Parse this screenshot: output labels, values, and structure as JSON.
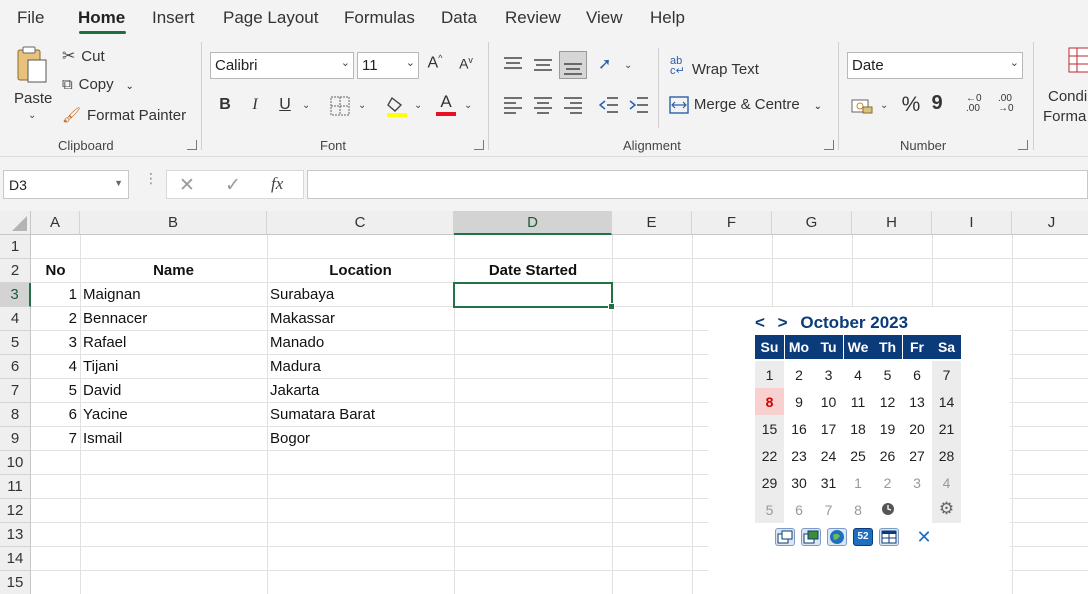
{
  "menu": {
    "tabs": [
      {
        "label": "File"
      },
      {
        "label": "Home"
      },
      {
        "label": "Insert"
      },
      {
        "label": "Page Layout"
      },
      {
        "label": "Formulas"
      },
      {
        "label": "Data"
      },
      {
        "label": "Review"
      },
      {
        "label": "View"
      },
      {
        "label": "Help"
      }
    ],
    "active_tab": "Home"
  },
  "ribbon": {
    "clipboard": {
      "paste": "Paste",
      "cut": "Cut",
      "copy": "Copy",
      "format_painter": "Format Painter",
      "group_label": "Clipboard"
    },
    "font": {
      "font_name": "Calibri",
      "font_size": "11",
      "bold": "B",
      "italic": "I",
      "underline": "U",
      "font_color": "#e81123",
      "highlight_color": "#ffff00",
      "group_label": "Font"
    },
    "alignment": {
      "wrap_text": "Wrap Text",
      "merge_centre": "Merge & Centre",
      "group_label": "Alignment"
    },
    "number": {
      "format": "Date",
      "percent": "%",
      "comma": "9",
      "group_label": "Number"
    },
    "cond_format": {
      "label_line1": "Condi",
      "label_line2": "Forma"
    }
  },
  "formula_bar": {
    "name_box": "D3",
    "fx": "fx",
    "formula": ""
  },
  "sheet": {
    "columns": [
      "A",
      "B",
      "C",
      "D",
      "E",
      "F",
      "G",
      "H",
      "I",
      "J"
    ],
    "selected_column": "D",
    "rows": [
      "1",
      "2",
      "3",
      "4",
      "5",
      "6",
      "7",
      "8",
      "9",
      "10",
      "11",
      "12",
      "13",
      "14",
      "15"
    ],
    "selected_row": "3",
    "headers": {
      "no": "No",
      "name": "Name",
      "location": "Location",
      "date_started": "Date Started"
    },
    "records": [
      {
        "no": "1",
        "name": "Maignan",
        "location": "Surabaya"
      },
      {
        "no": "2",
        "name": "Bennacer",
        "location": "Makassar"
      },
      {
        "no": "3",
        "name": "Rafael",
        "location": "Manado"
      },
      {
        "no": "4",
        "name": "Tijani",
        "location": "Madura"
      },
      {
        "no": "5",
        "name": "David",
        "location": "Jakarta"
      },
      {
        "no": "6",
        "name": "Yacine",
        "location": "Sumatara Barat"
      },
      {
        "no": "7",
        "name": "Ismail",
        "location": "Bogor"
      }
    ]
  },
  "date_picker": {
    "prev": "<",
    "next": ">",
    "month_year": "October 2023",
    "weekday_headers": [
      "Su",
      "Mo",
      "Tu",
      "We",
      "Th",
      "Fr",
      "Sa"
    ],
    "weeks": [
      [
        "1",
        "2",
        "3",
        "4",
        "5",
        "6",
        "7"
      ],
      [
        "8",
        "9",
        "10",
        "11",
        "12",
        "13",
        "14"
      ],
      [
        "15",
        "16",
        "17",
        "18",
        "19",
        "20",
        "21"
      ],
      [
        "22",
        "23",
        "24",
        "25",
        "26",
        "27",
        "28"
      ],
      [
        "29",
        "30",
        "31",
        "1",
        "2",
        "3",
        "4"
      ],
      [
        "5",
        "6",
        "7",
        "8",
        "",
        "",
        ""
      ]
    ],
    "today": "8",
    "header_color": "#0b3b78",
    "today_color": "#d20000",
    "toolbar_icons": [
      "window-icon",
      "window-alt-icon",
      "globe-icon",
      "week-52-icon",
      "calendar-icon",
      "close-icon"
    ]
  }
}
